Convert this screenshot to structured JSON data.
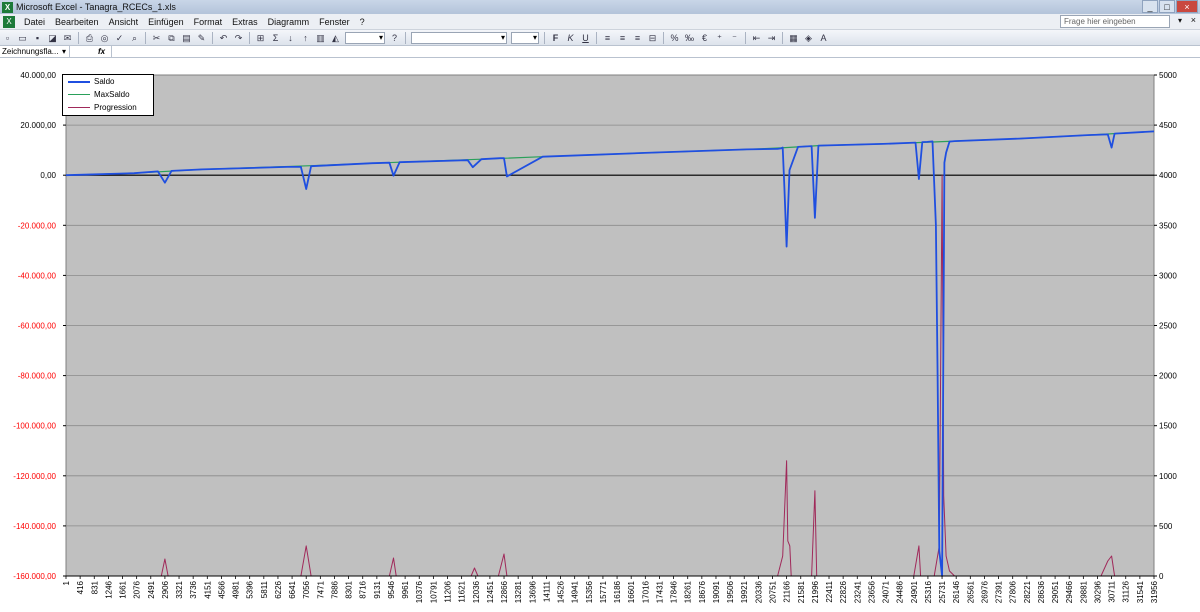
{
  "window": {
    "title": "Microsoft Excel - Tanagra_RCECs_1.xls",
    "app_icon": "X",
    "buttons": [
      "_",
      "□",
      "×"
    ]
  },
  "menu": {
    "items": [
      "Datei",
      "Bearbeiten",
      "Ansicht",
      "Einfügen",
      "Format",
      "Extras",
      "Diagramm",
      "Fenster",
      "?"
    ],
    "help_placeholder": "Frage hier eingeben",
    "help_close": "×"
  },
  "formula_bar": {
    "name_box": "Zeichnungsfla...",
    "fx": "fx"
  },
  "colors": {
    "plot_bg": "#c0c0c0",
    "saldo": "#1f4fe0",
    "maxsaldo": "#2aa05a",
    "progression": "#a0295a",
    "negative_tick": "#ff0000"
  },
  "chart_data": {
    "type": "line",
    "title": "",
    "xlabel": "",
    "ylabel": "",
    "ylim": [
      -160000,
      40000
    ],
    "y2lim": [
      0,
      5000
    ],
    "legend_position": "top-left",
    "grid": true,
    "y_ticks": [
      "40.000,00",
      "20.000,00",
      "0,00",
      "-20.000,00",
      "-40.000,00",
      "-60.000,00",
      "-80.000,00",
      "-100.000,00",
      "-120.000,00",
      "-140.000,00",
      "-160.000,00"
    ],
    "y2_ticks": [
      "5000",
      "4500",
      "4000",
      "3500",
      "3000",
      "2500",
      "2000",
      "1500",
      "1000",
      "500",
      "0"
    ],
    "x_ticks": [
      "1",
      "416",
      "831",
      "1246",
      "1661",
      "2076",
      "2491",
      "2906",
      "3321",
      "3736",
      "4151",
      "4566",
      "4981",
      "5396",
      "5811",
      "6226",
      "6641",
      "7056",
      "7471",
      "7886",
      "8301",
      "8716",
      "9131",
      "9546",
      "9961",
      "10376",
      "10791",
      "11206",
      "11621",
      "12036",
      "12451",
      "12866",
      "13281",
      "13696",
      "14111",
      "14526",
      "14941",
      "15356",
      "15771",
      "16186",
      "16601",
      "17016",
      "17431",
      "17846",
      "18261",
      "18676",
      "19091",
      "19506",
      "19921",
      "20336",
      "20751",
      "21166",
      "21581",
      "21996",
      "22411",
      "22826",
      "23241",
      "23656",
      "24071",
      "24486",
      "24901",
      "25316",
      "25731",
      "26146",
      "26561",
      "26976",
      "27391",
      "27806",
      "28221",
      "28636",
      "29051",
      "29466",
      "29881",
      "30296",
      "30711",
      "31126",
      "31541",
      "31956"
    ],
    "xlim": [
      1,
      31956
    ],
    "series": [
      {
        "name": "Saldo",
        "axis": "left",
        "x": [
          1,
          2000,
          2700,
          2906,
          3100,
          4000,
          6500,
          6900,
          7056,
          7200,
          9000,
          9500,
          9620,
          9800,
          11600,
          11800,
          11950,
          12200,
          12750,
          12866,
          12950,
          14000,
          17000,
          20000,
          20900,
          21000,
          21050,
          21100,
          21166,
          21250,
          21500,
          21900,
          21996,
          22100,
          24000,
          24950,
          25050,
          25150,
          25300,
          25450,
          25550,
          25600,
          25650,
          25731,
          25800,
          25850,
          25950,
          26100,
          28000,
          30000,
          30400,
          30600,
          30711,
          30800,
          31956
        ],
        "y": [
          0,
          800,
          1500,
          -3000,
          1700,
          2300,
          3300,
          3300,
          -5500,
          3600,
          4800,
          5000,
          -200,
          5200,
          5900,
          6000,
          3200,
          6400,
          6800,
          6800,
          -500,
          7400,
          8900,
          10300,
          10500,
          10700,
          11000,
          -5000,
          -28500,
          2000,
          11300,
          11600,
          -17000,
          11800,
          12500,
          13000,
          -1500,
          13200,
          13300,
          13500,
          -20000,
          -80000,
          -150000,
          -160000,
          5000,
          9000,
          13400,
          13600,
          14600,
          16000,
          16200,
          16300,
          11000,
          16600,
          17500
        ]
      },
      {
        "name": "MaxSaldo",
        "axis": "left",
        "x": [
          1,
          2000,
          4000,
          7200,
          9800,
          12200,
          14000,
          17000,
          20000,
          21000,
          21500,
          22100,
          24000,
          25000,
          26100,
          28000,
          30000,
          31956
        ],
        "y": [
          0,
          800,
          2300,
          3800,
          5200,
          6400,
          7400,
          8900,
          10300,
          10900,
          11300,
          11800,
          12500,
          13000,
          13600,
          14600,
          16000,
          17500
        ]
      },
      {
        "name": "Progression",
        "axis": "right",
        "x": [
          1,
          2800,
          2906,
          3000,
          6900,
          7056,
          7200,
          9500,
          9620,
          9700,
          11900,
          12000,
          12100,
          12700,
          12866,
          12950,
          20900,
          21050,
          21166,
          21200,
          21260,
          21300,
          21900,
          21996,
          22050,
          24900,
          25050,
          25100,
          25500,
          25650,
          25731,
          25780,
          25850,
          25950,
          26100,
          30400,
          30600,
          30711,
          30800,
          31956
        ],
        "y": [
          0,
          0,
          170,
          0,
          0,
          300,
          0,
          0,
          180,
          0,
          0,
          80,
          0,
          0,
          220,
          0,
          0,
          200,
          1150,
          350,
          300,
          0,
          0,
          850,
          0,
          0,
          300,
          0,
          0,
          300,
          4000,
          800,
          200,
          50,
          0,
          0,
          150,
          200,
          0,
          0
        ]
      }
    ]
  }
}
